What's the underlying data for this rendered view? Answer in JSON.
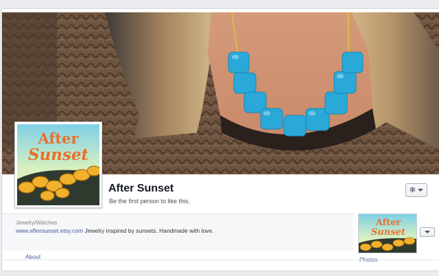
{
  "page": {
    "name": "After Sunset",
    "like_prompt": "Be the first person to like this.",
    "category": "Jewelry/Watches",
    "website": "www.aftersunset.etsy.com",
    "description": " Jewelry inspired by sunsets. Handmade with love.",
    "logo_text": "After Sunset"
  },
  "tabs": {
    "about": "About",
    "photos": "Photos"
  },
  "icons": {
    "gear": "gear-icon",
    "caret": "chevron-down-icon"
  },
  "colors": {
    "link": "#3b5998",
    "page_bg": "#e9ebee",
    "info_bg": "#f6f7f9",
    "necklace": "#2aa9d8"
  }
}
